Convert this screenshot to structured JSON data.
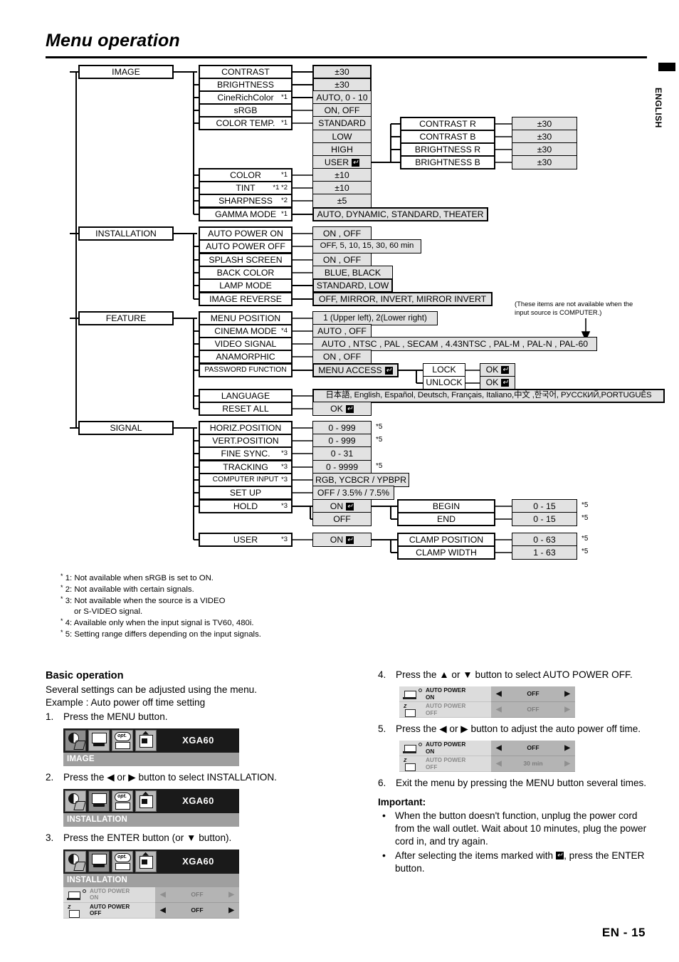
{
  "page": {
    "title": "Menu operation",
    "side_tab": "ENGLISH",
    "page_number": "EN - 15"
  },
  "diagram": {
    "note_computer": "(These items are not available when the\ninput source is COMPUTER.)",
    "menus": {
      "image": "IMAGE",
      "installation": "INSTALLATION",
      "feature": "FEATURE",
      "signal": "SIGNAL"
    },
    "image_items": [
      {
        "label": "CONTRAST",
        "fn": "",
        "value": "±30"
      },
      {
        "label": "BRIGHTNESS",
        "fn": "",
        "value": "±30"
      },
      {
        "label": "CineRichColor",
        "fn": "*1",
        "value": "AUTO, 0 - 10"
      },
      {
        "label": "sRGB",
        "fn": "",
        "value": "ON, OFF"
      },
      {
        "label": "COLOR TEMP.",
        "fn": "*1",
        "value": "STANDARD"
      }
    ],
    "color_temp_values": [
      "STANDARD",
      "LOW",
      "HIGH",
      "USER"
    ],
    "color_temp_user_sub": [
      {
        "label": "CONTRAST R",
        "value": "±30"
      },
      {
        "label": "CONTRAST B",
        "value": "±30"
      },
      {
        "label": "BRIGHTNESS R",
        "value": "±30"
      },
      {
        "label": "BRIGHTNESS B",
        "value": "±30"
      }
    ],
    "image_items2": [
      {
        "label": "COLOR",
        "fn": "*1",
        "value": "±10"
      },
      {
        "label": "TINT",
        "fn": "*1 *2",
        "value": "±10"
      },
      {
        "label": "SHARPNESS",
        "fn": "*2",
        "value": "±5"
      },
      {
        "label": "GAMMA MODE",
        "fn": "*1",
        "value": "AUTO, DYNAMIC, STANDARD, THEATER"
      }
    ],
    "installation_items": [
      {
        "label": "AUTO POWER ON",
        "fn": "",
        "value": "ON , OFF"
      },
      {
        "label": "AUTO POWER OFF",
        "fn": "",
        "value": "OFF,  5,  10,  15,  30,  60 min"
      },
      {
        "label": "SPLASH SCREEN",
        "fn": "",
        "value": "ON , OFF"
      },
      {
        "label": "BACK COLOR",
        "fn": "",
        "value": "BLUE, BLACK"
      },
      {
        "label": "LAMP MODE",
        "fn": "",
        "value": "STANDARD, LOW"
      },
      {
        "label": "IMAGE REVERSE",
        "fn": "",
        "value": "OFF, MIRROR, INVERT, MIRROR INVERT"
      }
    ],
    "feature_items": [
      {
        "label": "MENU POSITION",
        "fn": "",
        "value": "1 (Upper left), 2(Lower right)"
      },
      {
        "label": "CINEMA MODE",
        "fn": "*4",
        "value": "AUTO , OFF"
      },
      {
        "label": "VIDEO SIGNAL",
        "fn": "",
        "value": "AUTO , NTSC , PAL , SECAM , 4.43NTSC , PAL-M , PAL-N , PAL-60"
      },
      {
        "label": "ANAMORPHIC",
        "fn": "",
        "value": "ON , OFF"
      },
      {
        "label": "PASSWORD FUNCTION",
        "fn": "",
        "value": "MENU ACCESS"
      }
    ],
    "password_sub": [
      "LOCK",
      "UNLOCK"
    ],
    "password_ok": [
      "OK",
      "OK"
    ],
    "feature_items2": [
      {
        "label": "LANGUAGE",
        "fn": "",
        "value": "日本語, English, Español, Deutsch, Français, Italiano,中文 ,한국어, РУССКИЙ,PORTUGUÊS"
      },
      {
        "label": "RESET ALL",
        "fn": "",
        "value": "OK"
      }
    ],
    "signal_items": [
      {
        "label": "HORIZ.POSITION",
        "fn": "",
        "value": "0 - 999",
        "star": "*5"
      },
      {
        "label": "VERT.POSITION",
        "fn": "",
        "value": "0 - 999",
        "star": "*5"
      },
      {
        "label": "FINE SYNC.",
        "fn": "*3",
        "value": "0 - 31",
        "star": ""
      },
      {
        "label": "TRACKING",
        "fn": "*3",
        "value": "0 - 9999",
        "star": "*5"
      },
      {
        "label": "COMPUTER INPUT",
        "fn": "*3",
        "value": "RGB, YCBCR / YPBPR",
        "star": ""
      },
      {
        "label": "SET UP",
        "fn": "",
        "value": "OFF / 3.5% / 7.5%",
        "star": ""
      },
      {
        "label": "HOLD",
        "fn": "*3",
        "value": "ON",
        "star": ""
      }
    ],
    "hold_values": [
      "ON",
      "OFF"
    ],
    "hold_sub": [
      {
        "label": "BEGIN",
        "value": "0 - 15",
        "star": "*5"
      },
      {
        "label": "END",
        "value": "0 - 15",
        "star": "*5"
      }
    ],
    "user_item": {
      "label": "USER",
      "fn": "*3",
      "value": "ON"
    },
    "user_sub": [
      {
        "label": "CLAMP POSITION",
        "value": "0 - 63",
        "star": "*5"
      },
      {
        "label": "CLAMP WIDTH",
        "value": "1 - 63",
        "star": "*5"
      }
    ]
  },
  "footnotes": [
    "1: Not available when sRGB is set to ON.",
    "2: Not available with certain signals.",
    "3: Not available when the source is a VIDEO",
    "      or S-VIDEO signal.",
    "4: Available only when the input signal is TV60, 480i.",
    "5: Setting range differs depending on the input signals."
  ],
  "basic_operation": {
    "heading": "Basic operation",
    "intro1": "Several settings can be adjusted using the menu.",
    "intro2": "Example : Auto power off time setting",
    "step1_num": "1.",
    "step1": "Press the MENU button.",
    "step2_num": "2.",
    "step2": "Press the ◀ or ▶ button to select INSTALLATION.",
    "step3_num": "3.",
    "step3": "Press the ENTER button (or ▼ button).",
    "step4_num": "4.",
    "step4": "Press the ▲ or ▼ button to select AUTO POWER OFF.",
    "step5_num": "5.",
    "step5": "Press the ◀ or ▶ button to adjust the auto power off time.",
    "step6_num": "6.",
    "step6": "Exit the menu by pressing the MENU button several times."
  },
  "important": {
    "heading": "Important:",
    "bullet1": "When the button doesn't function,  unplug the power cord from the wall outlet. Wait about 10 minutes, plug the power cord in, and try again.",
    "bullet2_pre": "After selecting the items marked with",
    "bullet2_post": ", press the ENTER button."
  },
  "osd": {
    "source": "XGA60",
    "menu_image": "IMAGE",
    "menu_installation": "INSTALLATION",
    "row_apon_l1": "AUTO POWER",
    "row_apon_l2": "ON",
    "row_apoff_l1": "AUTO POWER",
    "row_apoff_l2": "OFF",
    "val_off": "OFF",
    "val_30min": "30 min",
    "arrow_left": "◀",
    "arrow_right": "▶",
    "opt_text": "opt."
  },
  "colors": {
    "shaded_box": "#e2e2e2",
    "osd_header": "#1a1a1a",
    "osd_menuname": "#9f9f9f",
    "osd_value": "#b4b4b4"
  }
}
